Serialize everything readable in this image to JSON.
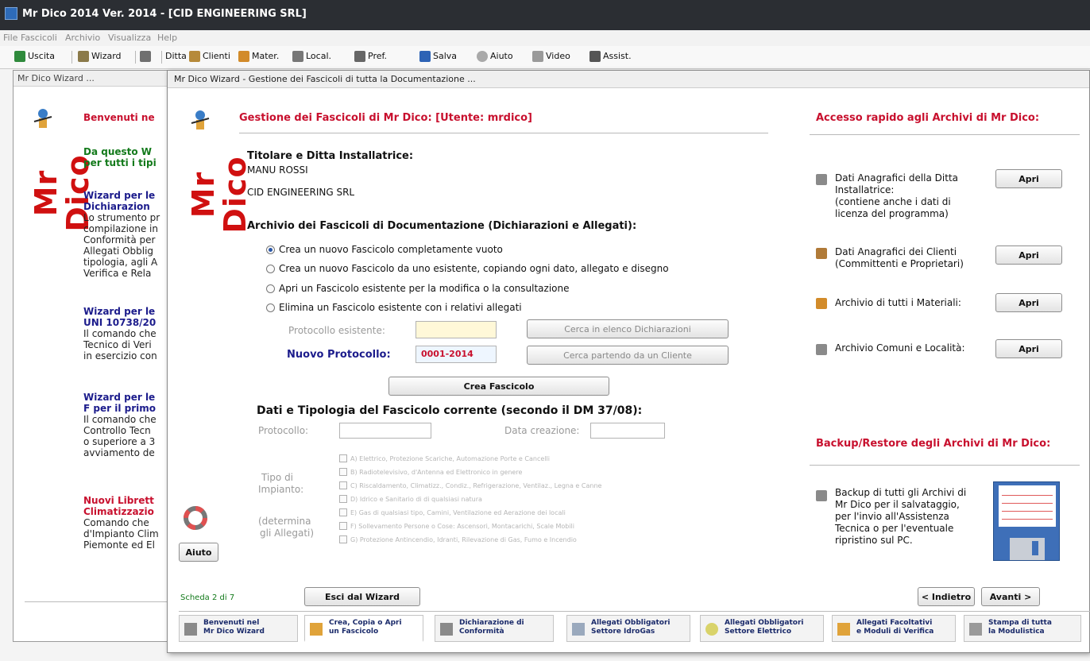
{
  "window": {
    "title": "Mr Dico 2014 Ver. 2014 -  [CID ENGINEERING SRL]"
  },
  "menu": [
    "File",
    "Fascicoli",
    "Archivio",
    "Visualizza",
    "Help"
  ],
  "toolbar": {
    "uscita": "Uscita",
    "wizard": "Wizard",
    "ditta": "Ditta",
    "clienti": "Clienti",
    "mater": "Mater.",
    "local": "Local.",
    "pref": "Pref.",
    "salva": "Salva",
    "aiuto": "Aiuto",
    "video": "Video",
    "assist": "Assist."
  },
  "bgwin": {
    "caption": "Mr Dico Wizard ...",
    "benvenuti": "Benvenuti ne",
    "daquesto1": "Da questo W",
    "daquesto2": "per tutti i tipi",
    "w1a": "Wizard per le",
    "w1b": "Dichiarazion",
    "p1": [
      "Lo strumento pr",
      "compilazione in",
      "Conformità per",
      "Allegati Obblig",
      "tipologia, agli A",
      "Verifica e Rela"
    ],
    "w2a": "Wizard per le",
    "w2b": "UNI 10738/20",
    "p2": [
      "Il comando che",
      "Tecnico di Veri",
      "in esercizio con"
    ],
    "w3a": "Wizard per le",
    "w3b": "F per il primo",
    "p3": [
      "Il comando che",
      "Controllo Tecn",
      "o superiore a 3",
      "avviamento de"
    ],
    "n1": "Nuovi Librett",
    "n2": "Climatizzazio",
    "p4": [
      "Comando che",
      "d'Impianto Clim",
      "Piemonte ed El"
    ]
  },
  "main": {
    "caption": "Mr Dico Wizard - Gestione dei Fascicoli di tutta la Documentazione ...",
    "heading": "Gestione dei Fascicoli di Mr Dico:  [Utente: mrdico]",
    "titolare_label": "Titolare e Ditta Installatrice:",
    "titolare_name": "MANU ROSSI",
    "ditta_name": "CID ENGINEERING SRL",
    "archivio_label": "Archivio dei Fascicoli di Documentazione (Dichiarazioni e Allegati):",
    "options": [
      "Crea un nuovo Fascicolo completamente vuoto",
      "Crea un nuovo Fascicolo da uno esistente, copiando ogni dato, allegato e disegno",
      "Apri un Fascicolo esistente per la modifica o la consultazione",
      "Elimina un Fascicolo esistente con i relativi allegati"
    ],
    "protocollo_esistente_label": "Protocollo esistente:",
    "cerca_dichiarazioni": "Cerca in elenco Dichiarazioni",
    "nuovo_protocollo_label": "Nuovo Protocollo:",
    "nuovo_protocollo_value": "0001-2014",
    "cerca_cliente": "Cerca partendo da un Cliente",
    "crea_fascicolo": "Crea Fascicolo",
    "dati_label": "Dati e Tipologia del Fascicolo corrente (secondo il DM 37/08):",
    "protocollo_label": "Protocollo:",
    "data_creazione_label": "Data creazione:",
    "tipo_label": [
      "Tipo di",
      "Impianto:"
    ],
    "determina_label": [
      "(determina",
      "gli Allegati)"
    ],
    "impianti": [
      "A) Elettrico, Protezione Scariche, Automazione Porte e Cancelli",
      "B) Radiotelevisivo, d'Antenna ed Elettronico in genere",
      "C) Riscaldamento, Climatizz., Condiz., Refrigerazione, Ventilaz., Legna e Canne",
      "D) Idrico e Sanitario di di qualsiasi natura",
      "E) Gas di qualsiasi tipo, Camini, Ventilazione ed Aerazione dei locali",
      "F) Sollevamento Persone o Cose: Ascensori, Montacarichi, Scale Mobili",
      "G) Protezione Antincendio, Idranti, Rilevazione di Gas, Fumo e Incendio"
    ],
    "aiuto": "Aiuto",
    "scheda": "Scheda 2 di 7",
    "esci": "Esci dal Wizard",
    "indietro": "< Indietro",
    "avanti": "Avanti >"
  },
  "right": {
    "accesso_heading": "Accesso rapido agli Archivi di Mr Dico:",
    "items": [
      {
        "text": [
          "Dati Anagrafici della Ditta",
          "Installatrice:",
          "(contiene anche i dati di",
          "licenza del programma)"
        ],
        "button": "Apri"
      },
      {
        "text": [
          "Dati Anagrafici dei Clienti",
          "(Committenti e Proprietari)"
        ],
        "button": "Apri"
      },
      {
        "text": [
          "Archivio di tutti i Materiali:"
        ],
        "button": "Apri"
      },
      {
        "text": [
          "Archivio Comuni e Località:"
        ],
        "button": "Apri"
      }
    ],
    "backup_heading": "Backup/Restore degli Archivi di Mr Dico:",
    "backup_text": [
      "Backup di tutti gli Archivi di",
      "Mr Dico per il salvataggio,",
      "per l'invio all'Assistenza",
      "Tecnica o per l'eventuale",
      "ripristino sul PC."
    ]
  },
  "tabs": [
    [
      "Benvenuti nel",
      "Mr Dico Wizard"
    ],
    [
      "Crea, Copia o Apri",
      "un Fascicolo"
    ],
    [
      "Dichiarazione di",
      "Conformità"
    ],
    [
      "Allegati Obbligatori",
      "Settore IdroGas"
    ],
    [
      "Allegati Obbligatori",
      "Settore Elettrico"
    ],
    [
      "Allegati Facoltativi",
      "e Moduli di Verifica"
    ],
    [
      "Stampa di tutta",
      "la Modulistica"
    ]
  ],
  "colors": {
    "red_heading": "#c8102e",
    "blue_heading": "#1c1c8c",
    "green_text": "#137a1b",
    "title_bar": "#2b2e33"
  }
}
